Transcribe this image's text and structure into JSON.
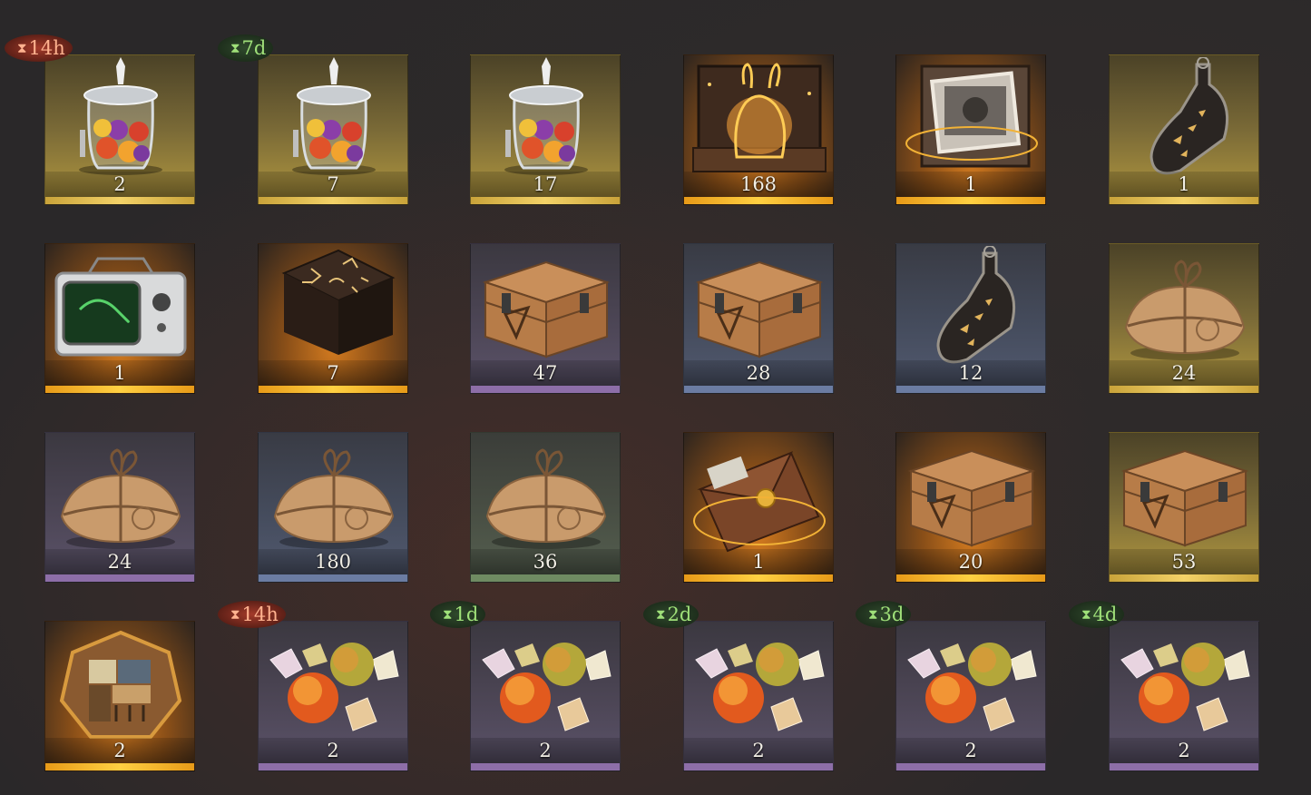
{
  "inventory": {
    "items": [
      {
        "name": "candy-jar",
        "count": "2",
        "rarity": "gold",
        "timer": "14h",
        "timer_color": "red"
      },
      {
        "name": "candy-jar",
        "count": "7",
        "rarity": "gold",
        "timer": "7d",
        "timer_color": "green"
      },
      {
        "name": "candy-jar",
        "count": "17",
        "rarity": "gold"
      },
      {
        "name": "rabbit-box",
        "count": "168",
        "rarity": "orange"
      },
      {
        "name": "photo-box",
        "count": "1",
        "rarity": "orange"
      },
      {
        "name": "bottle",
        "count": "1",
        "rarity": "gold"
      },
      {
        "name": "television",
        "count": "1",
        "rarity": "orange"
      },
      {
        "name": "rune-table",
        "count": "7",
        "rarity": "orange"
      },
      {
        "name": "crate",
        "count": "47",
        "rarity": "purple"
      },
      {
        "name": "crate",
        "count": "28",
        "rarity": "blue"
      },
      {
        "name": "bottle",
        "count": "12",
        "rarity": "blue"
      },
      {
        "name": "parcel",
        "count": "24",
        "rarity": "gold"
      },
      {
        "name": "parcel",
        "count": "24",
        "rarity": "purple"
      },
      {
        "name": "parcel",
        "count": "180",
        "rarity": "blue"
      },
      {
        "name": "parcel",
        "count": "36",
        "rarity": "green"
      },
      {
        "name": "envelope",
        "count": "1",
        "rarity": "orange"
      },
      {
        "name": "crate",
        "count": "20",
        "rarity": "orange"
      },
      {
        "name": "crate",
        "count": "53",
        "rarity": "gold"
      },
      {
        "name": "puzzle-box",
        "count": "2",
        "rarity": "orange"
      },
      {
        "name": "candy",
        "count": "2",
        "rarity": "purple",
        "timer": "14h",
        "timer_color": "red"
      },
      {
        "name": "candy",
        "count": "2",
        "rarity": "purple",
        "timer": "1d",
        "timer_color": "green"
      },
      {
        "name": "candy",
        "count": "2",
        "rarity": "purple",
        "timer": "2d",
        "timer_color": "green"
      },
      {
        "name": "candy",
        "count": "2",
        "rarity": "purple",
        "timer": "3d",
        "timer_color": "green"
      },
      {
        "name": "candy",
        "count": "2",
        "rarity": "purple",
        "timer": "4d",
        "timer_color": "green"
      }
    ]
  }
}
